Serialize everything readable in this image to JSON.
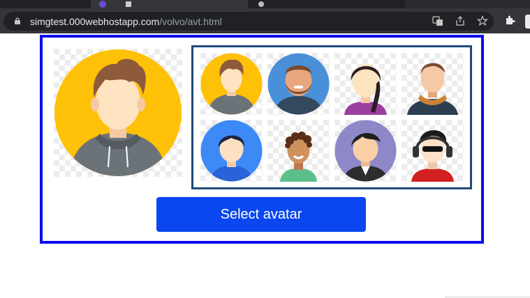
{
  "browser": {
    "url_host": "simgtest.000webhostapp.com",
    "url_path": "/volvo/avt.html",
    "icons": [
      "lock-icon",
      "translate-icon",
      "share-icon",
      "bookmark-star-icon",
      "extensions-icon",
      "profile-icon"
    ]
  },
  "page": {
    "select_button_label": "Select avatar",
    "frame_color": "#0a0af5",
    "grid_border_color": "#1e4a78",
    "button_color": "#0a47f0"
  },
  "avatars": [
    {
      "name": "hoodie-man-yellow",
      "bg": "#ffc107"
    },
    {
      "name": "bearded-man-blue",
      "bg": "#4a90d9"
    },
    {
      "name": "woman-braid",
      "bg": "none"
    },
    {
      "name": "man-scarf",
      "bg": "none"
    },
    {
      "name": "boy-blue",
      "bg": "#3d8af7"
    },
    {
      "name": "curly-boy-green",
      "bg": "none"
    },
    {
      "name": "boy-purple",
      "bg": "#8e88c9"
    },
    {
      "name": "headphones-man",
      "bg": "none"
    }
  ],
  "selected_avatar": "hoodie-man-yellow"
}
